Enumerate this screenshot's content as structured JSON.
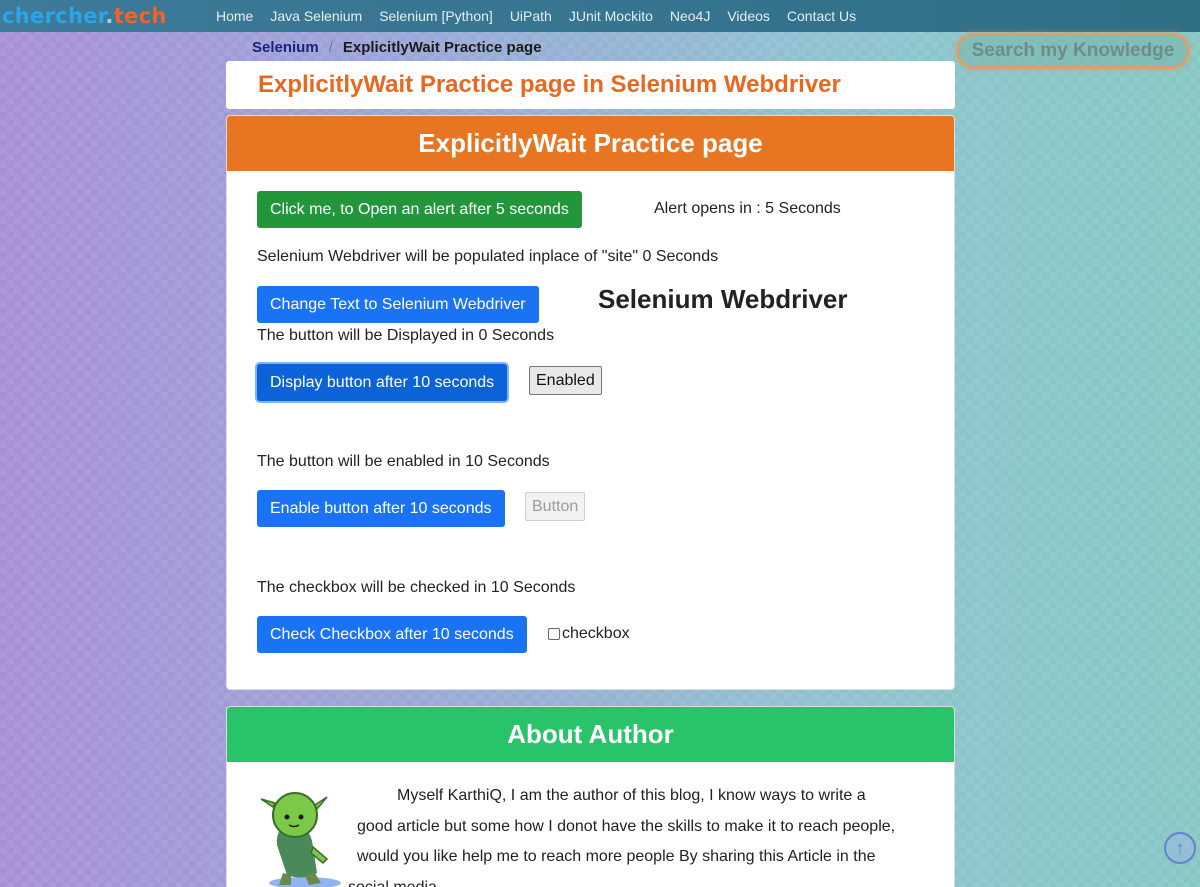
{
  "logo": {
    "part1": "chercher",
    "dot": ".",
    "part2": "tech"
  },
  "nav": {
    "items": [
      "Home",
      "Java Selenium",
      "Selenium [Python]",
      "UiPath",
      "JUnit Mockito",
      "Neo4J",
      "Videos",
      "Contact Us"
    ]
  },
  "breadcrumb": {
    "parent": "Selenium",
    "separator": "/",
    "current": "ExplicitlyWait Practice page"
  },
  "search": {
    "label": "Search my Knowledge"
  },
  "page_title": "ExplicitlyWait Practice page in Selenium Webdriver",
  "practice": {
    "header": "ExplicitlyWait Practice page",
    "alert_button": "Click me, to Open an alert after 5 seconds",
    "alert_status": "Alert opens in : 5 Seconds",
    "populate_text": "Selenium Webdriver will be populated inplace of \"site\" 0 Seconds",
    "change_text_button": "Change Text to Selenium Webdriver",
    "changed_text": "Selenium Webdriver",
    "display_text": "The button will be Displayed in 0 Seconds",
    "display_button": "Display button after 10 seconds",
    "enabled_button": "Enabled",
    "enable_text": "The button will be enabled in 10 Seconds",
    "enable_button": "Enable button after 10 seconds",
    "disabled_button": "Button",
    "checkbox_text": "The checkbox will be checked in 10 Seconds",
    "checkbox_button": "Check Checkbox after 10 seconds",
    "checkbox_label": "checkbox"
  },
  "author": {
    "header": "About Author",
    "bio_line1": "Myself KarthiQ, I am the author of this blog, I know ways to write a",
    "bio_line2": "good article but some how I donot have the skills to make it to reach people,",
    "bio_line3": "would you like help me to reach more people By sharing this Article in the",
    "bio_line4": "social media."
  },
  "scroll_top": {
    "icon": "arrow-up-icon",
    "glyph": "↑"
  },
  "colors": {
    "nav_bg": "#3e7a9a",
    "title_orange": "#e8681f",
    "card_header_orange": "#e87522",
    "author_green": "#29c46a",
    "btn_green": "#23963c",
    "btn_blue": "#1a73f5"
  }
}
